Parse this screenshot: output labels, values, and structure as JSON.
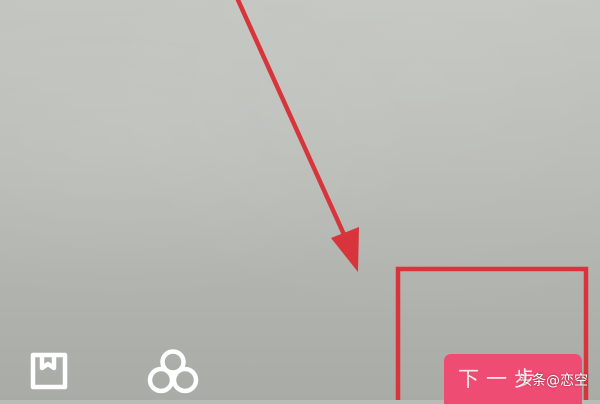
{
  "bottom_bar": {
    "drafts_icon": "bookmark-folder-icon",
    "effects_icon": "effects-circles-icon",
    "next_button": {
      "label": "下一步"
    }
  },
  "annotations": {
    "arrow_color": "#d8343b",
    "box_color": "#d8343b"
  },
  "watermark": {
    "text": "头条@恋空"
  }
}
